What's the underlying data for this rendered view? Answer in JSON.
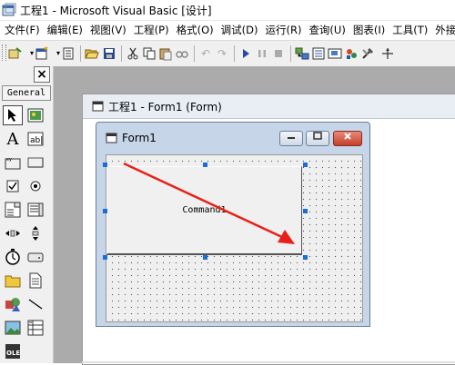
{
  "window": {
    "title": "工程1 - Microsoft Visual Basic [设计]"
  },
  "menu": {
    "items": [
      {
        "label": "文件(F)"
      },
      {
        "label": "编辑(E)"
      },
      {
        "label": "视图(V)"
      },
      {
        "label": "工程(P)"
      },
      {
        "label": "格式(O)"
      },
      {
        "label": "调试(D)"
      },
      {
        "label": "运行(R)"
      },
      {
        "label": "查询(U)"
      },
      {
        "label": "图表(I)"
      },
      {
        "label": "工具(T)"
      },
      {
        "label": "外接程"
      }
    ]
  },
  "toolbar": {
    "icons": [
      "add-project-icon",
      "add-form-icon",
      "menu-editor-icon",
      "open-icon",
      "save-icon",
      "cut-icon",
      "copy-icon",
      "paste-icon",
      "find-icon",
      "undo-icon",
      "redo-icon",
      "start-icon",
      "break-icon",
      "end-icon",
      "project-explorer-icon",
      "properties-window-icon",
      "form-layout-icon",
      "object-browser-icon",
      "toolbox-icon"
    ]
  },
  "toolbox": {
    "close_label": "×",
    "tab_label": "General",
    "tools": [
      "pointer",
      "picturebox",
      "label",
      "textbox",
      "frame",
      "commandbutton",
      "checkbox",
      "optionbutton",
      "combobox",
      "listbox",
      "hscrollbar",
      "vscrollbar",
      "timer",
      "drivelistbox",
      "dirlistbox",
      "filelistbox",
      "shape",
      "line",
      "image",
      "data",
      "ole"
    ]
  },
  "designer": {
    "container_title": "工程1 - Form1 (Form)",
    "form_title": "Form1",
    "button_caption": "Command1"
  },
  "colors": {
    "annotation_arrow": "#e8201a",
    "selection_handle": "#1a6ed8",
    "form_titlebar": "#c7d5e8",
    "close_button": "#c4402a"
  }
}
